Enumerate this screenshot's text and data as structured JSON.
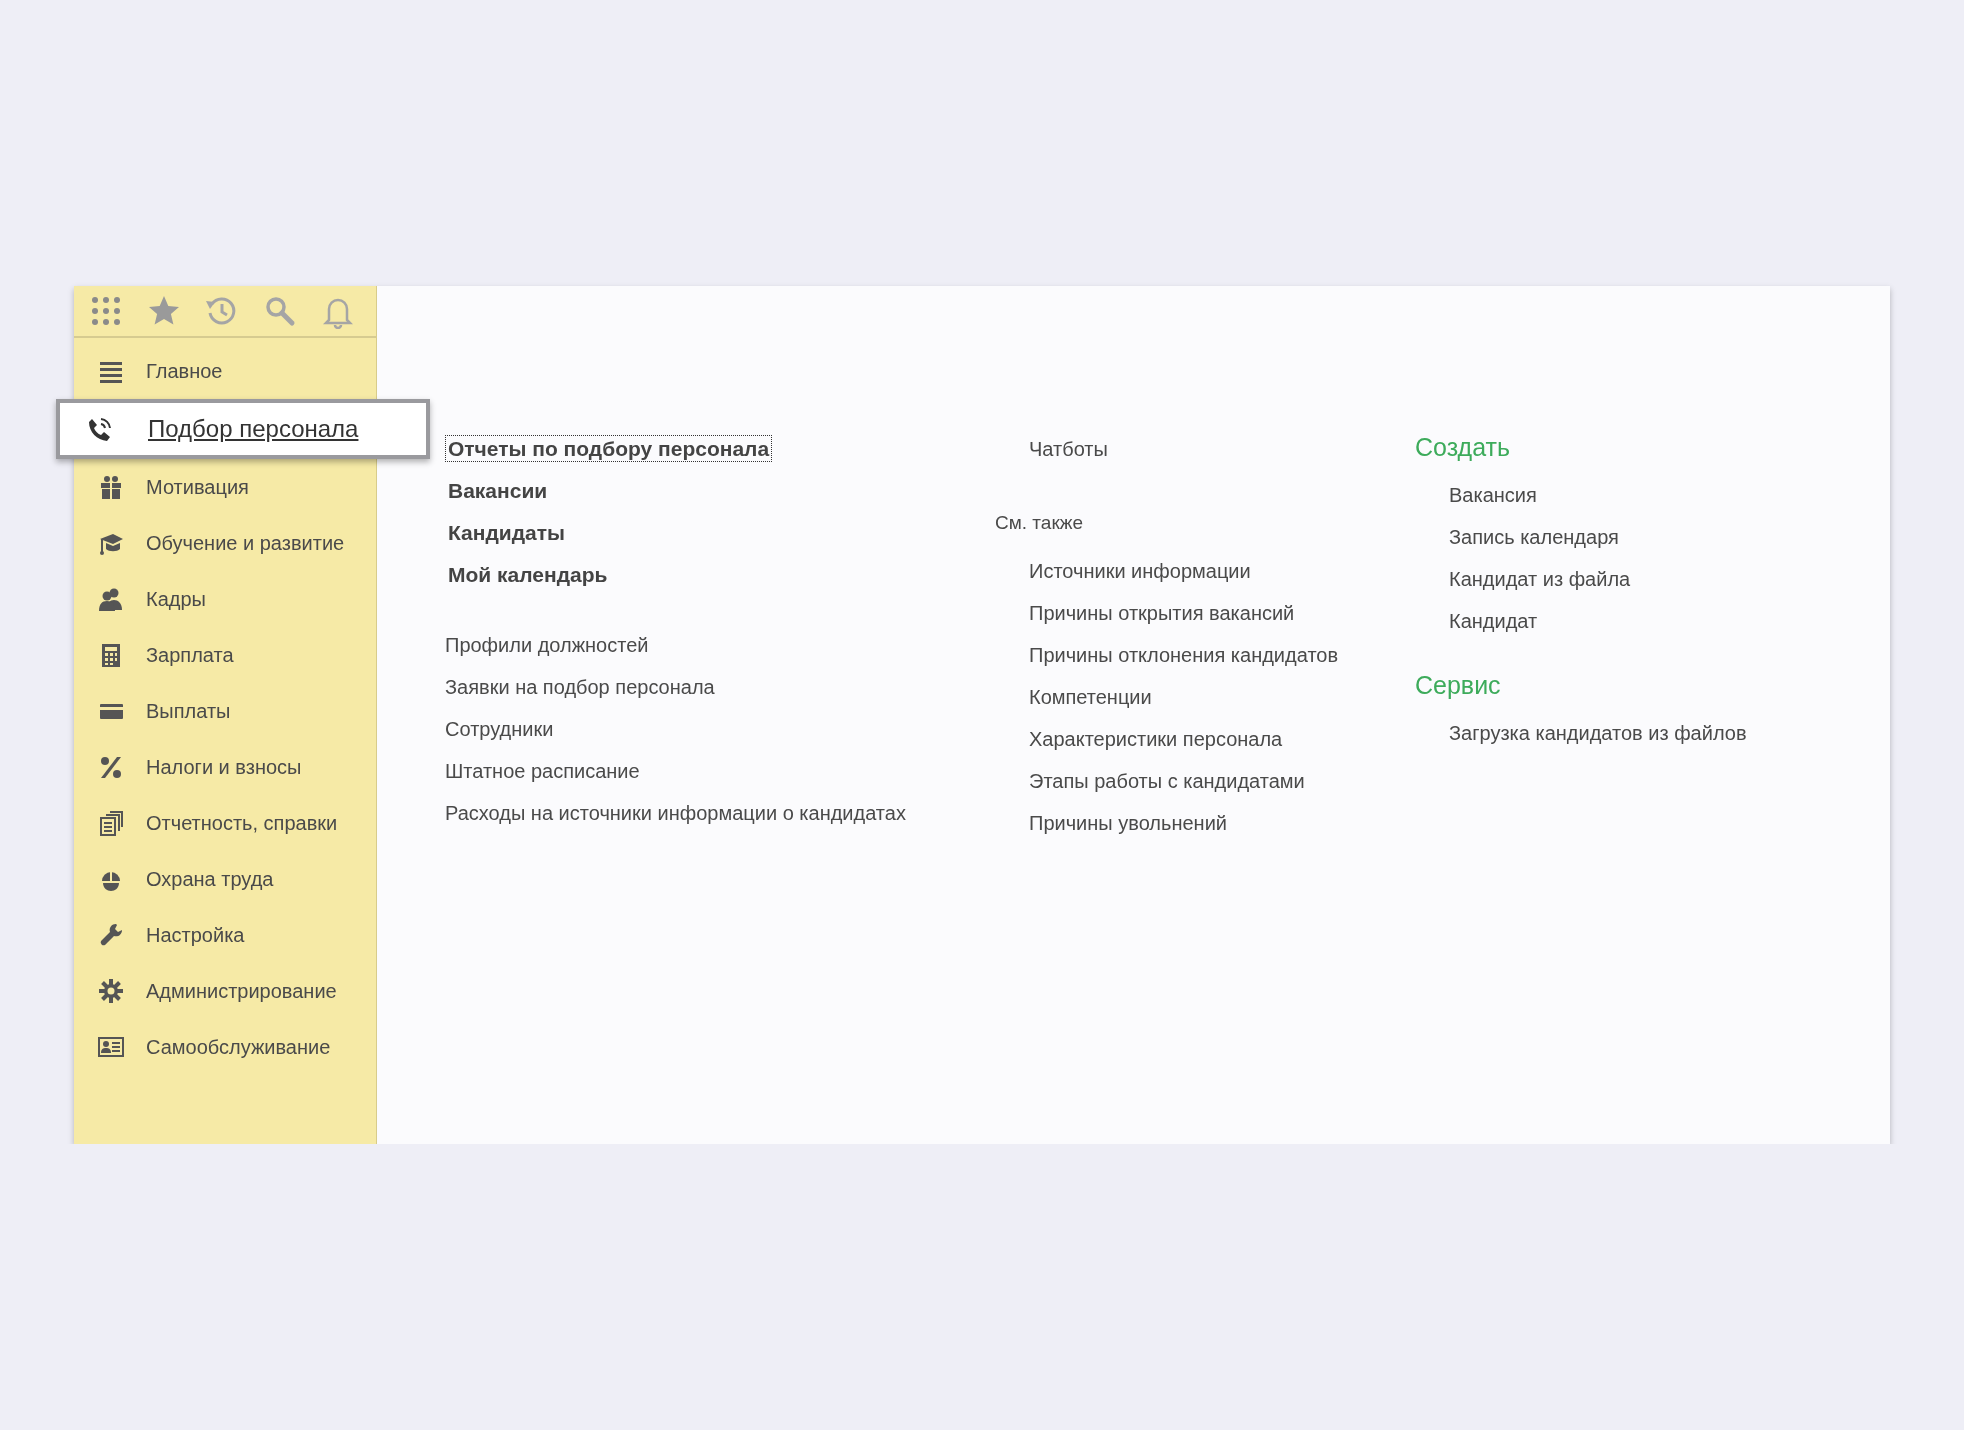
{
  "sidebar": {
    "items": [
      {
        "label": "Главное",
        "selected": false
      },
      {
        "label": "Подбор персонала",
        "selected": true
      },
      {
        "label": "Мотивация",
        "selected": false
      },
      {
        "label": "Обучение и развитие",
        "selected": false
      },
      {
        "label": "Кадры",
        "selected": false
      },
      {
        "label": "Зарплата",
        "selected": false
      },
      {
        "label": "Выплаты",
        "selected": false
      },
      {
        "label": "Налоги и взносы",
        "selected": false
      },
      {
        "label": "Отчетность, справки",
        "selected": false
      },
      {
        "label": "Охрана труда",
        "selected": false
      },
      {
        "label": "Настройка",
        "selected": false
      },
      {
        "label": "Администрирование",
        "selected": false
      },
      {
        "label": "Самообслуживание",
        "selected": false
      }
    ]
  },
  "content": {
    "column_1": {
      "primary_links": [
        {
          "label": "Отчеты по подбору персонала",
          "focused": true
        },
        {
          "label": "Вакансии",
          "focused": false
        },
        {
          "label": "Кандидаты",
          "focused": false
        },
        {
          "label": "Мой календарь",
          "focused": false
        }
      ],
      "links": [
        "Профили должностей",
        "Заявки на подбор персонала",
        "Сотрудники",
        "Штатное расписание",
        "Расходы на источники информации о кандидатах"
      ]
    },
    "column_2": {
      "links": [
        "Чатботы"
      ],
      "see_also": {
        "title": "См. также",
        "links": [
          "Источники информации",
          "Причины открытия вакансий",
          "Причины отклонения кандидатов",
          "Компетенции",
          "Характеристики персонала",
          "Этапы работы с кандидатами",
          "Причины увольнений"
        ]
      }
    },
    "column_3": {
      "sections": [
        {
          "title": "Создать",
          "links": [
            "Вакансия",
            "Запись календаря",
            "Кандидат из файла",
            "Кандидат"
          ]
        },
        {
          "title": "Сервис",
          "links": [
            "Загрузка кандидатов из файлов"
          ]
        }
      ]
    }
  }
}
